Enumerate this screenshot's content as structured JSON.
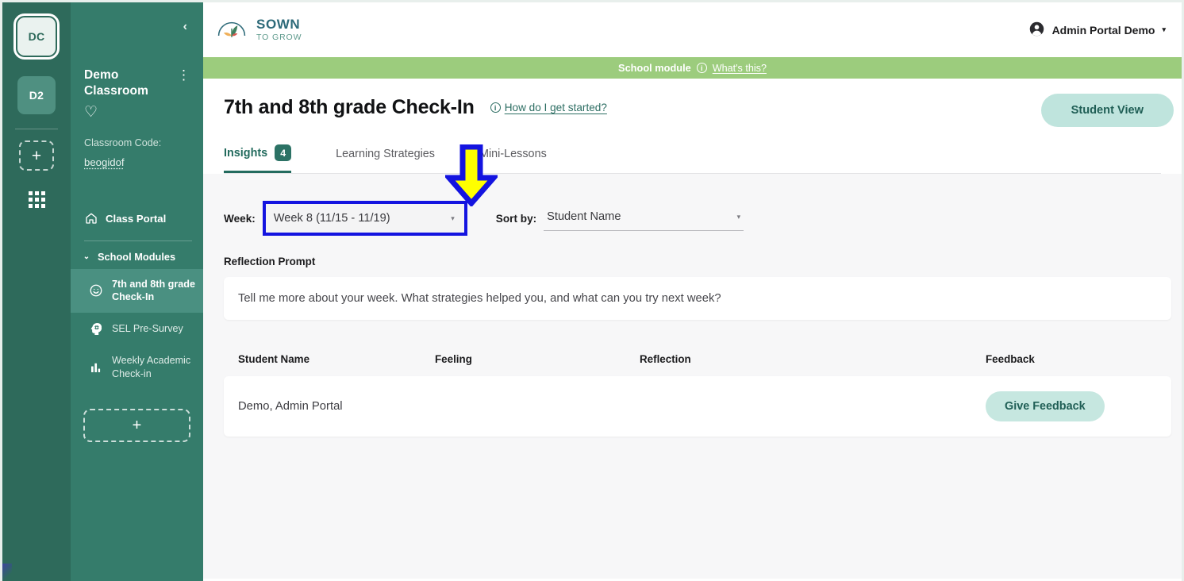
{
  "rail": {
    "tiles": [
      {
        "name": "classroom-dc",
        "label": "DC",
        "active": true
      },
      {
        "name": "classroom-d2",
        "label": "D2",
        "active": false
      }
    ],
    "add_label": "+",
    "grid_icon": "grid-icon"
  },
  "sidebar": {
    "collapse_icon": "‹",
    "classroom_name": "Demo Classroom",
    "kebab_icon": "⋮",
    "favorite_icon": "♡",
    "code_label": "Classroom Code:",
    "code_value": "beogidof",
    "class_portal": "Class Portal",
    "class_portal_icon": "home-icon",
    "group_label": "School Modules",
    "group_chevron": "⌄",
    "modules": [
      {
        "label": "7th and 8th grade Check-In",
        "icon": "smiley-face-icon",
        "active": true
      },
      {
        "label": "SEL Pre-Survey",
        "icon": "brain-gear-icon",
        "active": false
      },
      {
        "label": "Weekly Academic Check-in",
        "icon": "bar-chart-icon",
        "active": false
      }
    ],
    "add_module_label": "+"
  },
  "topbar": {
    "brand_top": "SOWN",
    "brand_bottom": "TO GROW",
    "brand_icon": "sprout-logo-icon",
    "account_name": "Admin Portal Demo",
    "account_icon": "user-avatar-icon",
    "account_caret": "▾"
  },
  "module_banner": {
    "text": "School module",
    "info_icon": "i",
    "link": "What's this?",
    "color": "#9ccc7d"
  },
  "page": {
    "title": "7th and 8th grade Check-In",
    "help_info_icon": "i",
    "help_link": "How do I get started?",
    "student_view_label": "Student View"
  },
  "tabs": [
    {
      "label": "Insights",
      "badge": "4",
      "active": true
    },
    {
      "label": "Learning Strategies",
      "badge": "",
      "active": false
    },
    {
      "label": "Mini-Lessons",
      "badge": "",
      "active": false
    }
  ],
  "controls": {
    "week_label": "Week:",
    "week_value": "Week 8 (11/15 - 11/19)",
    "week_caret": "▾",
    "sort_label": "Sort by:",
    "sort_value": "Student Name",
    "sort_caret": "▾",
    "highlight_color": "#1414e0"
  },
  "reflection": {
    "label": "Reflection Prompt",
    "prompt": "Tell me more about your week. What strategies helped you, and what can you try next week?"
  },
  "table": {
    "headers": {
      "student_name": "Student Name",
      "feeling": "Feeling",
      "reflection": "Reflection",
      "feedback": "Feedback"
    },
    "rows": [
      {
        "student_name": "Demo, Admin Portal",
        "feeling": "",
        "reflection": "",
        "feedback_label": "Give Feedback"
      }
    ]
  },
  "annotation": {
    "type": "down-arrow",
    "fill": "#ffff00",
    "stroke": "#1414e0"
  }
}
